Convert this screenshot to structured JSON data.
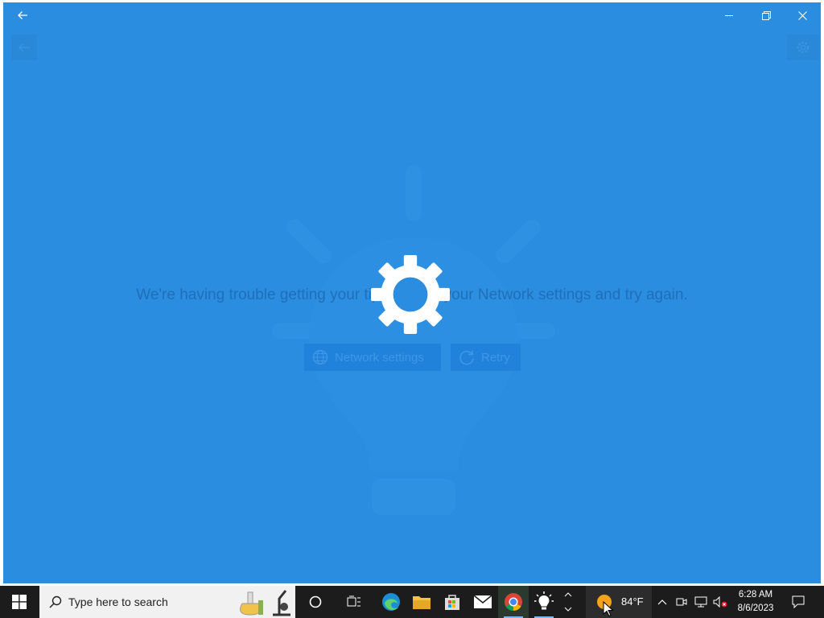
{
  "window": {
    "titlebar": {
      "back_icon": "back-arrow-icon",
      "minimize_icon": "minimize-icon",
      "maximize_icon": "restore-icon",
      "close_icon": "close-icon"
    },
    "content": {
      "message": "We're having trouble getting your tips. Check your Network settings and try again.",
      "network_button_label": "Network settings",
      "retry_button_label": "Retry",
      "loading_icon": "gear-icon"
    }
  },
  "taskbar": {
    "search_placeholder": "Type here to search",
    "weather_temp": "84°F",
    "time": "6:28 AM",
    "date": "8/6/2023"
  },
  "colors": {
    "window_bg": "#2b8de0",
    "taskbar_bg": "#1c1c1c",
    "accent": "#2b8de0"
  }
}
